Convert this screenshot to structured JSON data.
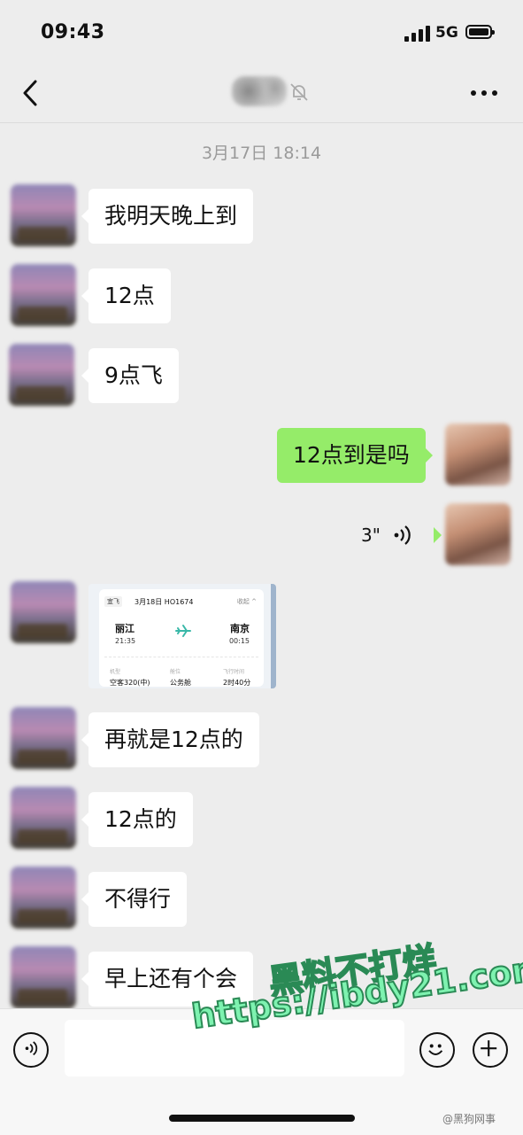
{
  "status_bar": {
    "time": "09:43",
    "network": "5G"
  },
  "chat": {
    "timestamp": "3月17日 18:14",
    "messages": [
      {
        "side": "left",
        "text": "我明天晚上到"
      },
      {
        "side": "left",
        "text": "12点"
      },
      {
        "side": "left",
        "text": "9点飞"
      },
      {
        "side": "right",
        "text": "12点到是吗"
      },
      {
        "side": "right",
        "voice_duration": "3\""
      },
      {
        "side": "left",
        "type": "flight-card"
      },
      {
        "side": "left",
        "text": "再就是12点的"
      },
      {
        "side": "left",
        "text": "12点的"
      },
      {
        "side": "left",
        "text": "不得行"
      },
      {
        "side": "left",
        "text": "早上还有个会"
      }
    ]
  },
  "flight_card": {
    "tag": "宜飞",
    "date_flight": "3月18日 HO1674",
    "status": "收起 ^",
    "departure_city": "丽江",
    "departure_time": "21:35",
    "arrival_city": "南京",
    "arrival_time": "00:15",
    "label_aircraft": "机型",
    "label_cabin": "舱位",
    "label_duration": "飞行时间",
    "aircraft": "空客320(中)",
    "cabin": "公务舱",
    "duration": "2时40分"
  },
  "watermark": {
    "line1": "黑料不打烊",
    "line2": "https://ibdy21.com"
  },
  "weibo_mark": "@黑狗网事",
  "icons": [
    "back-arrow-icon",
    "mute-bell-icon",
    "more-dots-icon",
    "voice-wave-icon",
    "plane-icon",
    "voice-input-icon",
    "emoji-icon",
    "plus-icon"
  ],
  "colors": {
    "background": "#ededed",
    "own_bubble": "#95ec69",
    "other_bubble": "#ffffff",
    "timestamp": "#9a9a9a"
  }
}
